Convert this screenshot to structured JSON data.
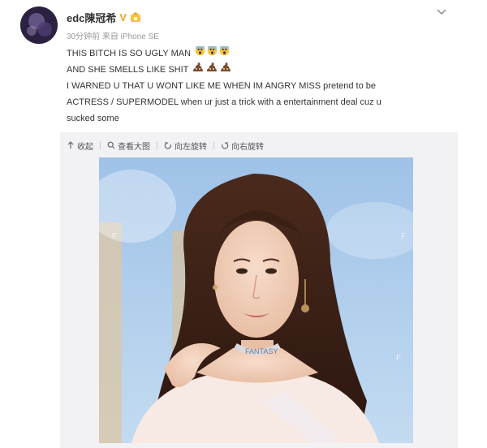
{
  "user": {
    "name": "edc陳冠希",
    "verified_mark": "V",
    "meta": "30分钟前 来自 iPhone SE"
  },
  "post": {
    "lines": [
      "THIS BITCH IS SO UGLY MAN",
      "AND SHE SMELLS LIKE SHIT",
      "I WARNED U THAT U WONT LIKE ME WHEN IM ANGRY MISS pretend to be",
      "ACTRESS / SUPERMODEL when ur just a trick with a entertainment deal cuz u",
      "sucked some"
    ],
    "emoji_line1": "scream-emoji",
    "emoji_line2": "poop-emoji"
  },
  "toolbar": {
    "collapse": "收起",
    "view_large": "查看大图",
    "rotate_left": "向左旋转",
    "rotate_right": "向右旋转"
  },
  "photo": {
    "sash_text": "FANTASY",
    "watermark": "F"
  },
  "colors": {
    "accent_v": "#f5a623",
    "text": "#333333",
    "meta": "#999999",
    "media_bg": "#f2f2f5",
    "photo_sky": "#aecbe8"
  }
}
